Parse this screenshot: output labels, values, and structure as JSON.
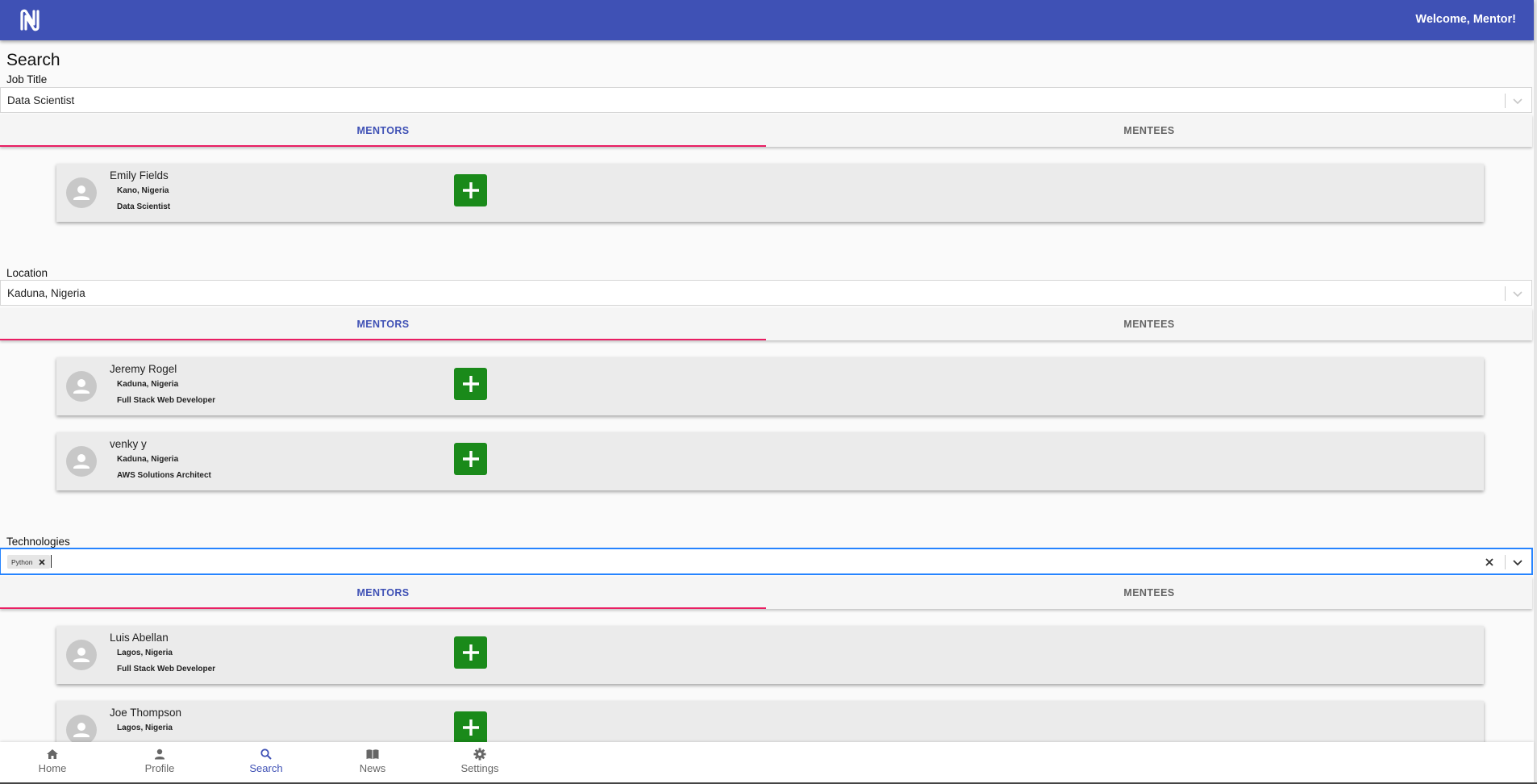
{
  "header": {
    "welcome": "Welcome, Mentor!",
    "logo_icon": "n-logo-icon"
  },
  "page": {
    "title": "Search"
  },
  "sections": [
    {
      "label": "Job Title",
      "value": "Data Scientist",
      "tabs": [
        "MENTORS",
        "MENTEES"
      ],
      "active_tab": "MENTORS",
      "results": [
        {
          "name": "Emily Fields",
          "location": "Kano, Nigeria",
          "job": "Data Scientist"
        }
      ]
    },
    {
      "label": "Location",
      "value": "Kaduna, Nigeria",
      "tabs": [
        "MENTORS",
        "MENTEES"
      ],
      "active_tab": "MENTORS",
      "results": [
        {
          "name": "Jeremy Rogel",
          "location": "Kaduna, Nigeria",
          "job": "Full Stack Web Developer"
        },
        {
          "name": "venky y",
          "location": "Kaduna, Nigeria",
          "job": "AWS Solutions Architect"
        }
      ]
    },
    {
      "label": "Technologies",
      "chips": [
        "Python"
      ],
      "tabs": [
        "MENTORS",
        "MENTEES"
      ],
      "active_tab": "MENTORS",
      "results": [
        {
          "name": "Luis Abellan",
          "location": "Lagos, Nigeria",
          "job": "Full Stack Web Developer"
        },
        {
          "name": "Joe Thompson",
          "location": "Lagos, Nigeria",
          "job": ""
        }
      ]
    }
  ],
  "bottom_nav": [
    {
      "label": "Home",
      "icon": "home-icon"
    },
    {
      "label": "Profile",
      "icon": "person-icon"
    },
    {
      "label": "Search",
      "icon": "search-icon",
      "active": true
    },
    {
      "label": "News",
      "icon": "book-icon"
    },
    {
      "label": "Settings",
      "icon": "gear-icon"
    }
  ],
  "colors": {
    "app_bar": "#3f51b5",
    "tab_indicator": "#e91e63",
    "add_button": "#1a8a1a",
    "card_background": "#ebebeb"
  }
}
